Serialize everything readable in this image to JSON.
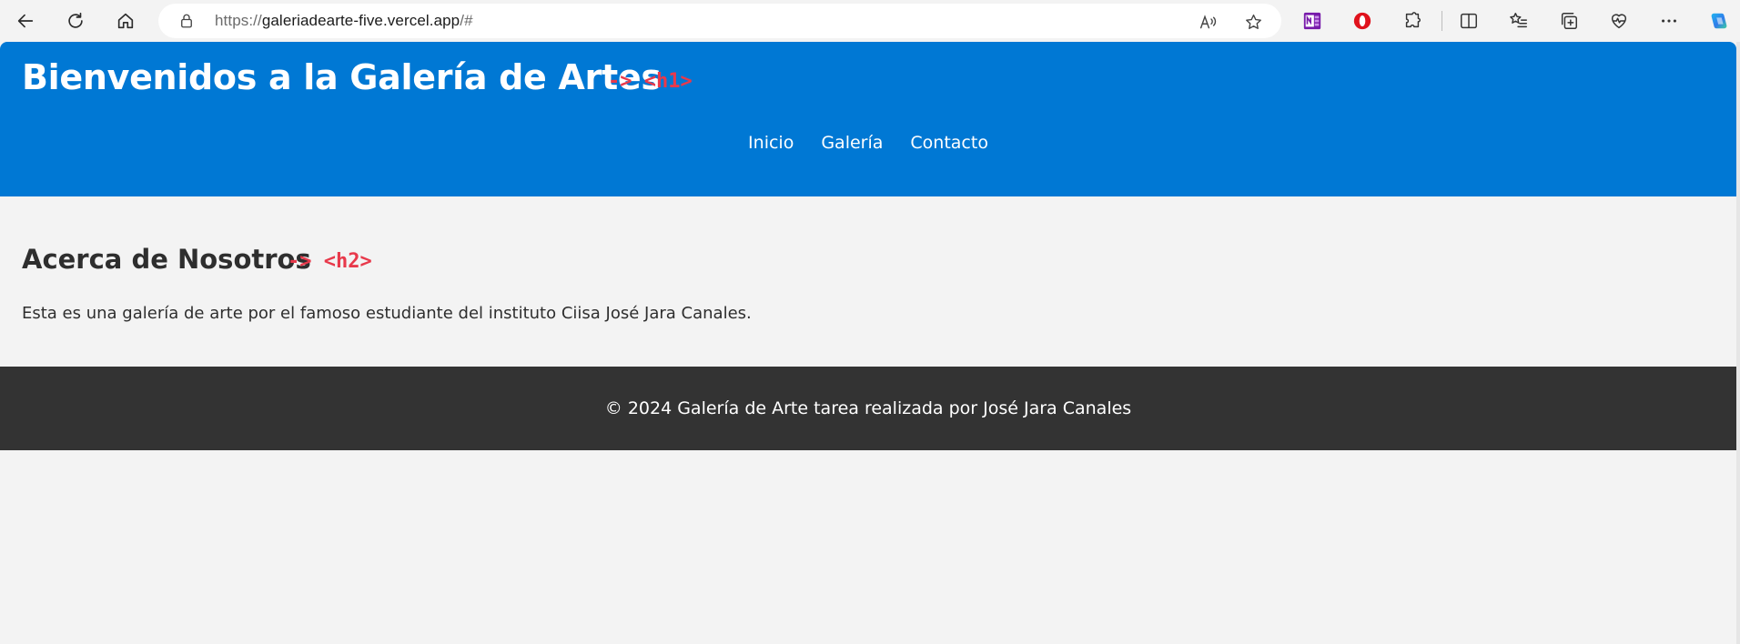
{
  "browser": {
    "url": {
      "protocol": "https://",
      "host": "galeriadearte-five.vercel.app",
      "path": "/#"
    },
    "icons": {
      "back": "back-arrow-icon",
      "refresh": "refresh-icon",
      "home": "home-icon",
      "lock": "lock-icon",
      "read_aloud": "read-aloud-icon",
      "favorite": "star-icon",
      "onenote": "onenote-icon",
      "opera": "opera-icon",
      "extensions": "puzzle-icon",
      "split_screen": "split-screen-icon",
      "favorites": "favorites-list-icon",
      "collections": "collections-icon",
      "browser_essentials": "heart-pulse-icon",
      "more": "more-icon",
      "copilot": "copilot-icon"
    }
  },
  "header": {
    "title": "Bienvenidos a la Galería de Artes",
    "annotation": "-> <h1>",
    "nav": [
      "Inicio",
      "Galería",
      "Contacto"
    ]
  },
  "about": {
    "title": "Acerca de Nosotros",
    "annotation": "-> <h2>",
    "text": "Esta es una galería de arte por el famoso estudiante del instituto Ciisa José Jara Canales."
  },
  "footer": {
    "text": "© 2024 Galería de Arte tarea realizada por José Jara Canales"
  },
  "colors": {
    "header_bg": "#0078d4",
    "footer_bg": "#333333",
    "page_bg": "#f3f3f3",
    "annotation": "#e8394b",
    "text": "#2e2e2e"
  }
}
